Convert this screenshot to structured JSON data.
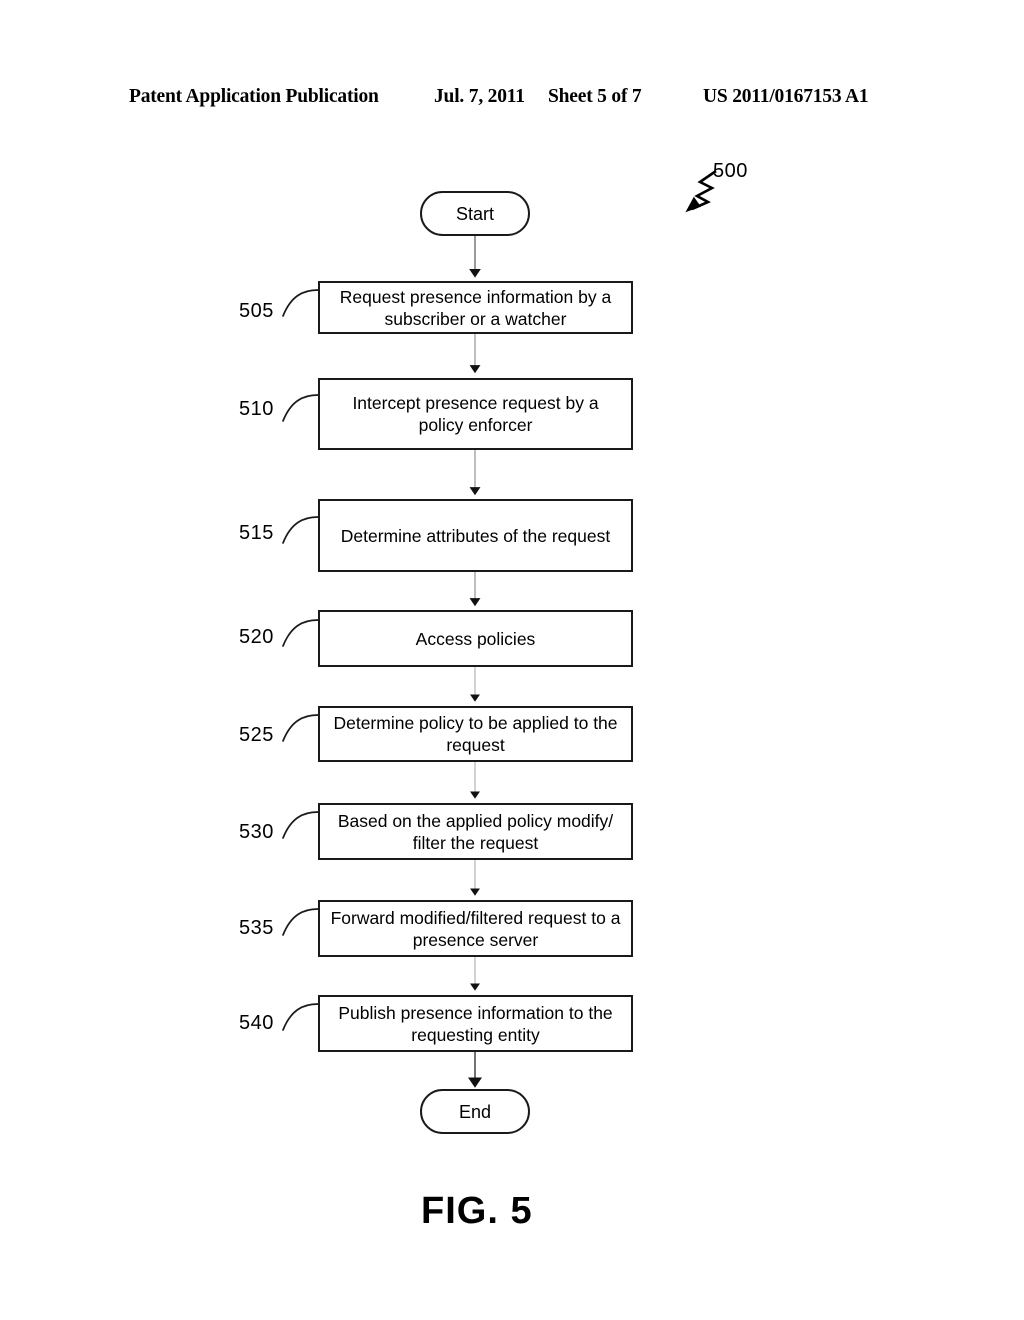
{
  "header": {
    "publication": "Patent Application Publication",
    "date": "Jul. 7, 2011",
    "sheet": "Sheet 5 of 7",
    "patent_number": "US 2011/0167153 A1"
  },
  "figure": {
    "caption": "FIG. 5",
    "diagram_reference": "500"
  },
  "diagram": {
    "type": "flowchart",
    "orientation": "vertical",
    "start": {
      "label": "Start",
      "shape": "terminator"
    },
    "end": {
      "label": "End",
      "shape": "terminator"
    },
    "steps": [
      {
        "ref": "505",
        "label": "Request presence information by a subscriber or a watcher"
      },
      {
        "ref": "510",
        "label": "Intercept presence request by a policy enforcer"
      },
      {
        "ref": "515",
        "label": "Determine attributes of the request"
      },
      {
        "ref": "520",
        "label": "Access policies"
      },
      {
        "ref": "525",
        "label": "Determine policy to be applied to the request"
      },
      {
        "ref": "530",
        "label": "Based on the applied policy modify/ filter the request"
      },
      {
        "ref": "535",
        "label": "Forward modified/filtered request to a presence server"
      },
      {
        "ref": "540",
        "label": "Publish presence information to the requesting entity"
      }
    ],
    "colors": {
      "stroke": "#1a1a1a",
      "connector": "#4d4d4d",
      "background": "#ffffff",
      "text": "#000000"
    }
  }
}
